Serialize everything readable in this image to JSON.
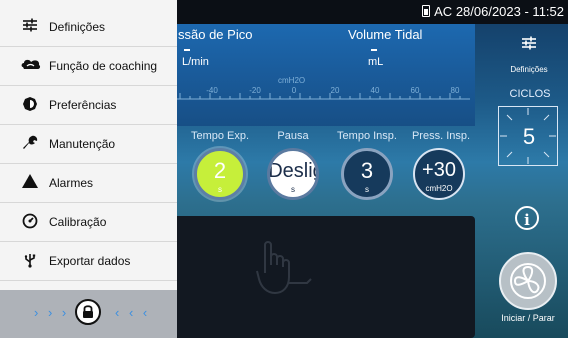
{
  "status": {
    "mode": "AC",
    "datetime": "28/06/2023 - 11:52"
  },
  "top_panel": {
    "peak_label": "ssão de Pico",
    "tidal_label": "Volume Tidal",
    "peak_unit": "L/min",
    "tidal_unit": "mL",
    "scale_unit": "cmH2O",
    "scale_ticks": [
      "-40",
      "-20",
      "0",
      "20",
      "40",
      "60",
      "80"
    ]
  },
  "settings_button": {
    "label": "Definições",
    "icon": "settings-sliders-icon"
  },
  "cycles": {
    "label": "CICLOS",
    "value": "5"
  },
  "params": [
    {
      "name": "Tempo Exp.",
      "value": "2",
      "unit": "s"
    },
    {
      "name": "Pausa",
      "value": "Deslig",
      "unit": "s"
    },
    {
      "name": "Tempo Insp.",
      "value": "3",
      "unit": "s"
    },
    {
      "name": "Press. Insp.",
      "value": "+30",
      "unit": "cmH2O"
    }
  ],
  "start_stop": {
    "label": "Iniciar / Parar"
  },
  "menu": [
    {
      "label": "Definições",
      "icon": "settings-sliders-icon"
    },
    {
      "label": "Função de coaching",
      "icon": "coaching-icon"
    },
    {
      "label": "Preferências",
      "icon": "preferences-gear-icon"
    },
    {
      "label": "Manutenção",
      "icon": "wrench-icon"
    },
    {
      "label": "Alarmes",
      "icon": "alarm-triangle-icon"
    },
    {
      "label": "Calibração",
      "icon": "gauge-icon"
    },
    {
      "label": "Exportar dados",
      "icon": "usb-icon"
    }
  ],
  "lock": {
    "left_chevrons": "› › ›",
    "right_chevrons": "‹ ‹ ‹",
    "icon": "lock-icon"
  },
  "colors": {
    "drawer_bg": "#f4f4f4",
    "panel_blue": "#1a5c9c",
    "active_dial": "#c6ef3a",
    "chevron_blue": "#3c8fe0"
  }
}
